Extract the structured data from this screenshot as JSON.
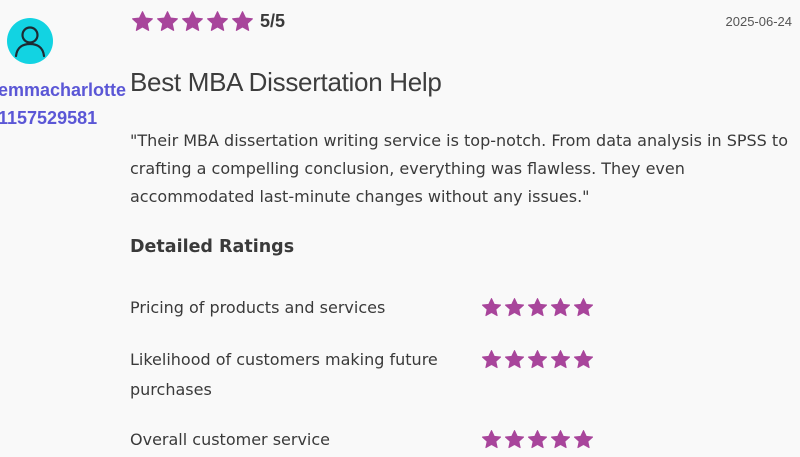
{
  "reviewer": {
    "username": "emmacharlotte1157529581",
    "avatar_icon": "user-icon",
    "avatar_color": "#12d3e2",
    "username_color": "#5b57d6"
  },
  "review": {
    "rating_stars": 5,
    "rating_text": "5/5",
    "date": "2025-06-24",
    "title": "Best MBA Dissertation Help",
    "body": "\"Their MBA dissertation writing service is top-notch. From data analysis in SPSS to crafting a compelling conclusion, everything was flawless. They even accommodated last-minute changes without any issues.\""
  },
  "detailed": {
    "heading": "Detailed Ratings",
    "criteria": [
      {
        "label": "Pricing of products and services",
        "stars": 5
      },
      {
        "label": "Likelihood of customers making future purchases",
        "stars": 5
      },
      {
        "label": "Overall customer service",
        "stars": 5
      }
    ]
  },
  "colors": {
    "star": "#a8459b",
    "text": "#3a3a3a",
    "background": "#f9f9f9"
  },
  "icons": {
    "star": "star-icon"
  }
}
